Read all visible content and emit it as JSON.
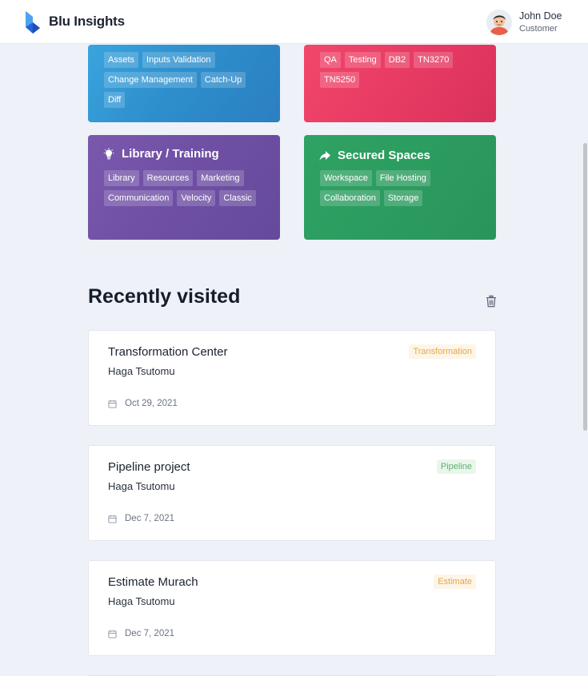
{
  "header": {
    "brand": "Blu Insights",
    "user": {
      "name": "John Doe",
      "role": "Customer"
    }
  },
  "cards": {
    "blue": {
      "tags": [
        "Assets",
        "Inputs Validation",
        "Change Management",
        "Catch-Up",
        "Diff"
      ]
    },
    "red": {
      "tags": [
        "QA",
        "Testing",
        "DB2",
        "TN3270",
        "TN5250"
      ]
    },
    "purple": {
      "title": "Library / Training",
      "icon": "lightbulb-icon",
      "tags": [
        "Library",
        "Resources",
        "Marketing",
        "Communication",
        "Velocity",
        "Classic"
      ]
    },
    "green": {
      "title": "Secured Spaces",
      "icon": "share-arrow-icon",
      "tags": [
        "Workspace",
        "File Hosting",
        "Collaboration",
        "Storage"
      ]
    }
  },
  "recent": {
    "title": "Recently visited",
    "items": [
      {
        "title": "Transformation Center",
        "author": "Haga Tsutomu",
        "date": "Oct 29, 2021",
        "badge": "Transformation",
        "badge_color": "#e8a749"
      },
      {
        "title": "Pipeline project",
        "author": "Haga Tsutomu",
        "date": "Dec 7, 2021",
        "badge": "Pipeline",
        "badge_color": "#5db36c"
      },
      {
        "title": "Estimate Murach",
        "author": "Haga Tsutomu",
        "date": "Dec 7, 2021",
        "badge": "Estimate",
        "badge_color": "#e8a749"
      }
    ]
  },
  "colors": {
    "blue_card": "#2e8fcd",
    "red_card": "#e63a63",
    "purple_card": "#6e4fa4",
    "green_card": "#2c9b5f"
  }
}
